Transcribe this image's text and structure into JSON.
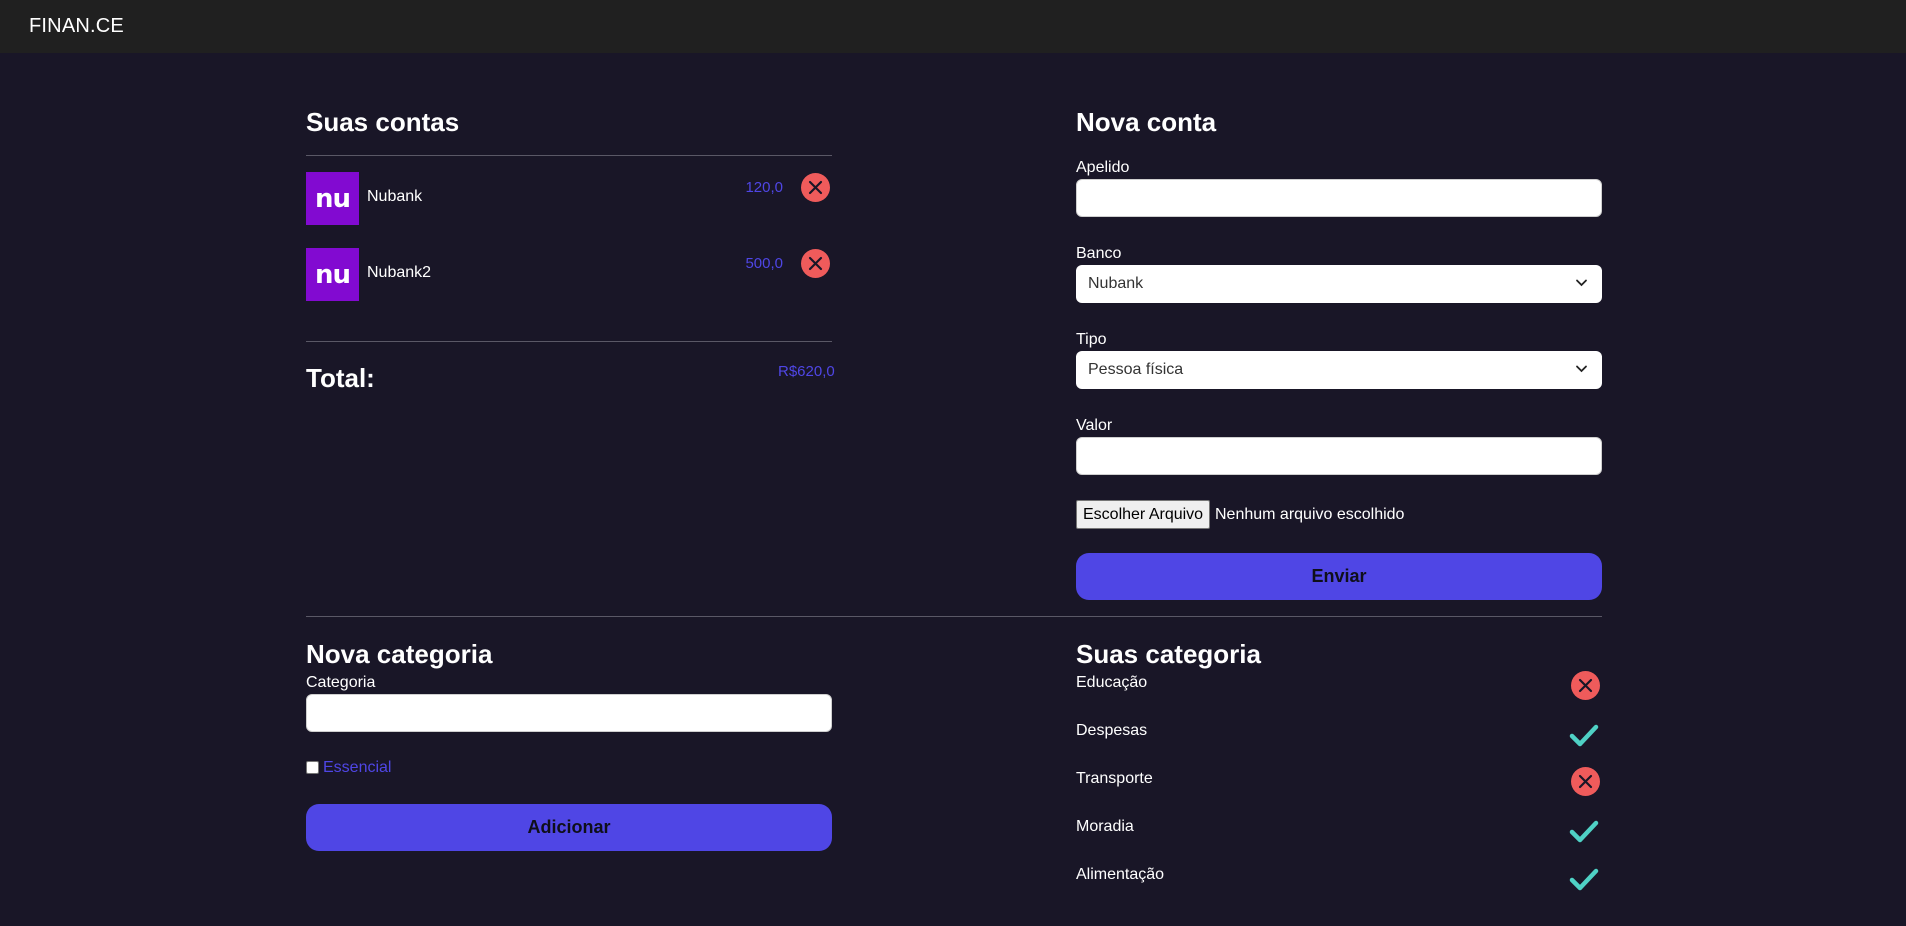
{
  "app": {
    "brand": "FINAN.CE"
  },
  "accounts": {
    "title": "Suas contas",
    "items": [
      {
        "logo": "nu",
        "name": "Nubank",
        "value": "120,0"
      },
      {
        "logo": "nu",
        "name": "Nubank2",
        "value": "500,0"
      }
    ],
    "total_label": "Total:",
    "total_value": "R$620,0"
  },
  "new_account": {
    "title": "Nova conta",
    "nickname_label": "Apelido",
    "nickname_value": "",
    "bank_label": "Banco",
    "bank_selected": "Nubank",
    "type_label": "Tipo",
    "type_selected": "Pessoa física",
    "value_label": "Valor",
    "value_value": "",
    "file_button": "Escolher Arquivo",
    "file_status": "Nenhum arquivo escolhido",
    "submit_label": "Enviar"
  },
  "new_category": {
    "title": "Nova categoria",
    "category_label": "Categoria",
    "category_value": "",
    "essential_label": "Essencial",
    "essential_checked": false,
    "submit_label": "Adicionar"
  },
  "categories": {
    "title": "Suas categoria",
    "items": [
      {
        "name": "Educação",
        "essential": false,
        "icon": "close-icon"
      },
      {
        "name": "Despesas",
        "essential": true,
        "icon": "check-icon"
      },
      {
        "name": "Transporte",
        "essential": false,
        "icon": "close-icon"
      },
      {
        "name": "Moradia",
        "essential": true,
        "icon": "check-icon"
      },
      {
        "name": "Alimentação",
        "essential": true,
        "icon": "check-icon"
      }
    ]
  },
  "colors": {
    "background": "#191627",
    "topbar": "#202020",
    "accent": "#4f46e5",
    "danger": "#ef5b5b",
    "success": "#4fd1c5",
    "nubank": "#820ad1"
  }
}
